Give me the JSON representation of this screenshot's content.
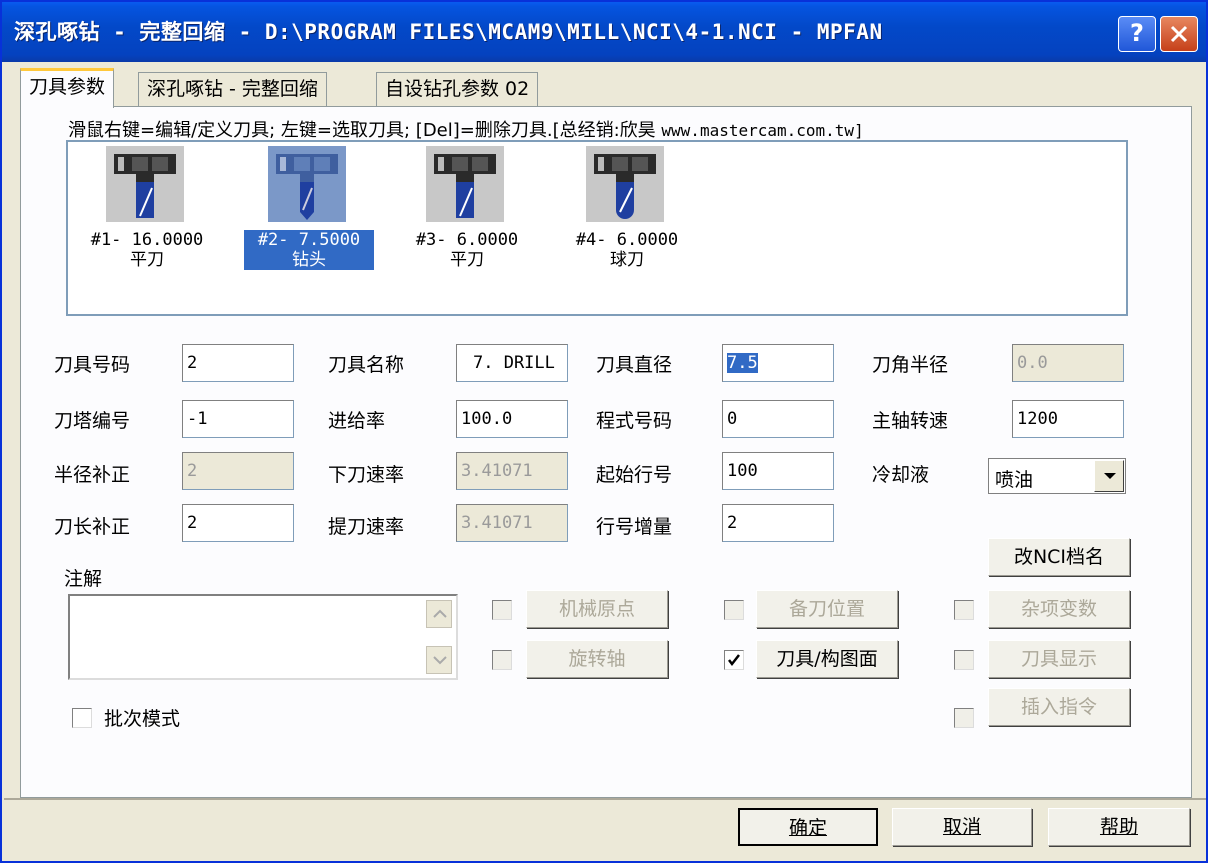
{
  "window": {
    "title": "深孔啄钻 - 完整回缩 - D:\\PROGRAM FILES\\MCAM9\\MILL\\NCI\\4-1.NCI - MPFAN",
    "help_glyph": "?",
    "close_icon": "close-icon"
  },
  "tabs": [
    {
      "label": "刀具参数",
      "active": true
    },
    {
      "label": "深孔啄钻 - 完整回缩",
      "active": false
    },
    {
      "label": "自设钻孔参数 02",
      "active": false
    }
  ],
  "hint": {
    "text": "滑鼠右键=编辑/定义刀具; 左键=选取刀具; [Del]=删除刀具.[总经销:欣昊",
    "url": "www.mastercam.com.tw]"
  },
  "tools": [
    {
      "line1": "#1- 16.0000",
      "line2": "平刀",
      "icon": "flat-endmill-icon",
      "selected": false
    },
    {
      "line1": "#2- 7.5000",
      "line2": "钻头",
      "icon": "drill-icon",
      "selected": true
    },
    {
      "line1": "#3- 6.0000",
      "line2": "平刀",
      "icon": "flat-endmill-icon",
      "selected": false
    },
    {
      "line1": "#4- 6.0000",
      "line2": "球刀",
      "icon": "ball-endmill-icon",
      "selected": false
    }
  ],
  "params": {
    "tool_number_label": "刀具号码",
    "tool_number": "2",
    "tool_name_label": "刀具名称",
    "tool_name": "7. DRILL",
    "tool_diameter_label": "刀具直径",
    "tool_diameter": "7.5",
    "corner_radius_label": "刀角半径",
    "corner_radius": "0.0",
    "turret_label": "刀塔编号",
    "turret": "-1",
    "feed_label": "进给率",
    "feed": "100.0",
    "program_label": "程式号码",
    "program": "0",
    "spindle_label": "主轴转速",
    "spindle": "1200",
    "radius_comp_label": "半径补正",
    "radius_comp": "2",
    "plunge_label": "下刀速率",
    "plunge": "3.41071",
    "start_seq_label": "起始行号",
    "start_seq": "100",
    "coolant_label": "冷却液",
    "coolant": "喷油",
    "length_comp_label": "刀长补正",
    "length_comp": "2",
    "retract_label": "提刀速率",
    "retract": "3.41071",
    "seq_inc_label": "行号增量",
    "seq_inc": "2"
  },
  "buttons": {
    "rename_nci": "改NCI档名",
    "notes_label": "注解",
    "home": "机械原点",
    "ref_point": "备刀位置",
    "misc": "杂项变数",
    "rotary": "旋转轴",
    "tool_plane": "刀具/构图面",
    "tool_display": "刀具显示",
    "insert": "插入指令",
    "batch": "批次模式",
    "ok": "确定",
    "cancel": "取消",
    "help": "帮助"
  }
}
